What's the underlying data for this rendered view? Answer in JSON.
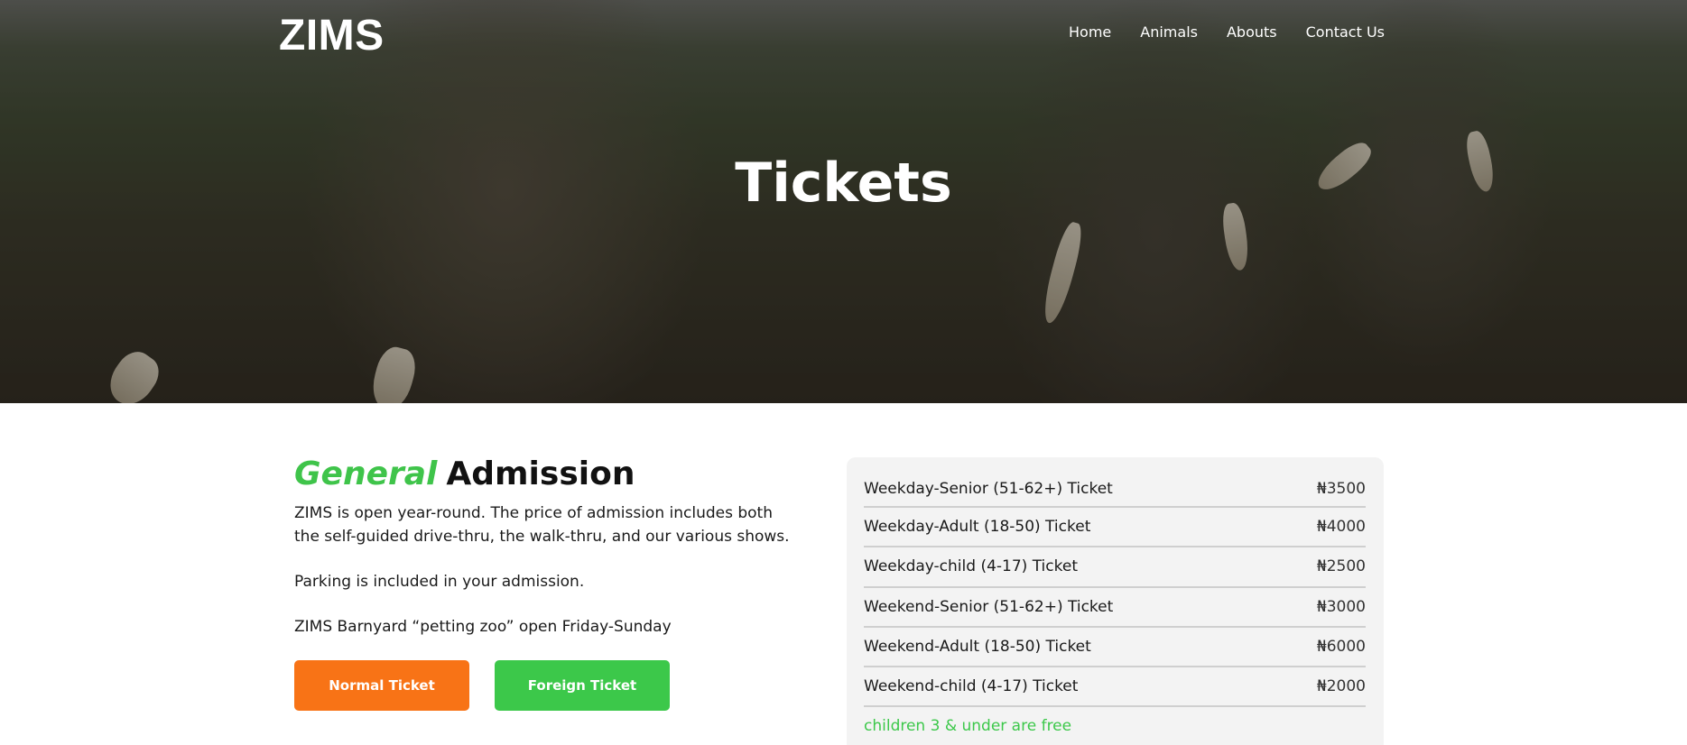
{
  "brand": "ZIMS",
  "nav": [
    "Home",
    "Animals",
    "Abouts",
    "Contact Us"
  ],
  "hero": {
    "title": "Tickets"
  },
  "admission": {
    "heading_accent": "General",
    "heading_rest": "Admission",
    "paragraphs": [
      "ZIMS is open year-round. The price of admission includes both the self-guided drive-thru, the walk-thru, and our various shows.",
      "Parking is included in your admission.",
      "ZIMS Barnyard “petting zoo” open Friday-Sunday"
    ],
    "buttons": {
      "normal": "Normal Ticket",
      "foreign": "Foreign Ticket"
    }
  },
  "tickets": [
    {
      "name": "Weekday-Senior (51-62+) Ticket",
      "price": "₦3500"
    },
    {
      "name": "Weekday-Adult (18-50) Ticket",
      "price": "₦4000"
    },
    {
      "name": "Weekday-child (4-17) Ticket",
      "price": "₦2500"
    },
    {
      "name": "Weekend-Senior (51-62+) Ticket",
      "price": "₦3000"
    },
    {
      "name": "Weekend-Adult (18-50) Ticket",
      "price": "₦6000"
    },
    {
      "name": "Weekend-child (4-17) Ticket",
      "price": "₦2000"
    }
  ],
  "tickets_note": "children 3 & under are free",
  "colors": {
    "accent_green": "#3cc84a",
    "accent_orange": "#f87316",
    "panel_bg": "#f3f3f3"
  }
}
